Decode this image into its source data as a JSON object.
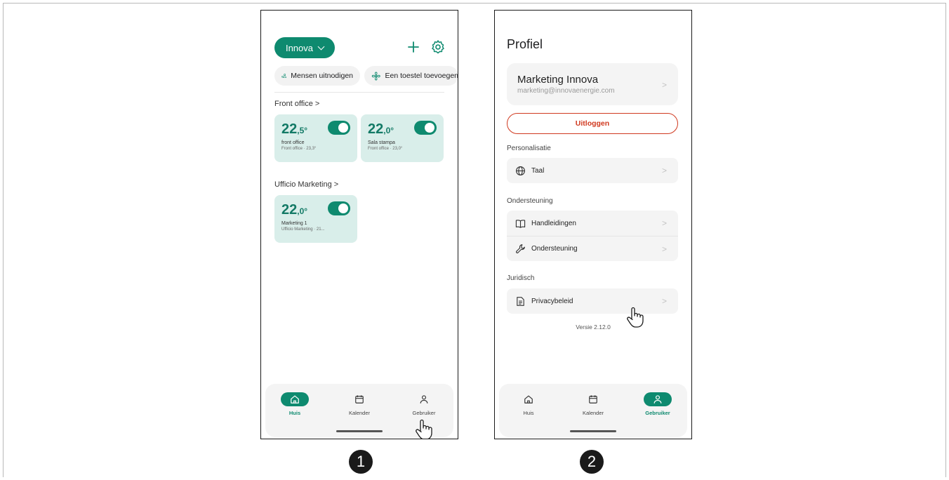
{
  "phone1": {
    "home_selector": "Innova",
    "chips": {
      "invite": "Mensen uitnodigen",
      "add_device": "Een toestel toevoegen"
    },
    "groups": [
      {
        "title": "Front office >",
        "cards": [
          {
            "temp_int": "22",
            "temp_dec": ",5°",
            "name": "front office",
            "sub": "Front office · 23,3°",
            "on": true
          },
          {
            "temp_int": "22",
            "temp_dec": ",0°",
            "name": "Sala stampa",
            "sub": "Front office · 23,0°",
            "on": true
          }
        ]
      },
      {
        "title": "Ufficio Marketing >",
        "cards": [
          {
            "temp_int": "22",
            "temp_dec": ",0°",
            "name": "Marketing 1",
            "sub": "Ufficio Marketing · 21...",
            "on": true
          }
        ]
      }
    ],
    "nav": {
      "home": "Huis",
      "calendar": "Kalender",
      "user": "Gebruiker",
      "active": "home"
    }
  },
  "phone2": {
    "title": "Profiel",
    "account": {
      "name": "Marketing Innova",
      "email": "marketing@innovaenergie.com"
    },
    "logout": "Uitloggen",
    "sections": [
      {
        "title": "Personalisatie",
        "items": [
          {
            "label": "Taal",
            "icon": "globe-icon"
          }
        ]
      },
      {
        "title": "Ondersteuning",
        "items": [
          {
            "label": "Handleidingen",
            "icon": "book-icon"
          },
          {
            "label": "Ondersteuning",
            "icon": "wrench-icon"
          }
        ]
      },
      {
        "title": "Juridisch",
        "items": [
          {
            "label": "Privacybeleid",
            "icon": "document-icon"
          }
        ]
      }
    ],
    "version": "Versie 2.12.0",
    "nav": {
      "home": "Huis",
      "calendar": "Kalender",
      "user": "Gebruiker",
      "active": "user"
    }
  },
  "steps": [
    "1",
    "2"
  ],
  "colors": {
    "accent": "#0e8a6f",
    "card_bg": "#d9eeea",
    "danger": "#d0391f"
  }
}
